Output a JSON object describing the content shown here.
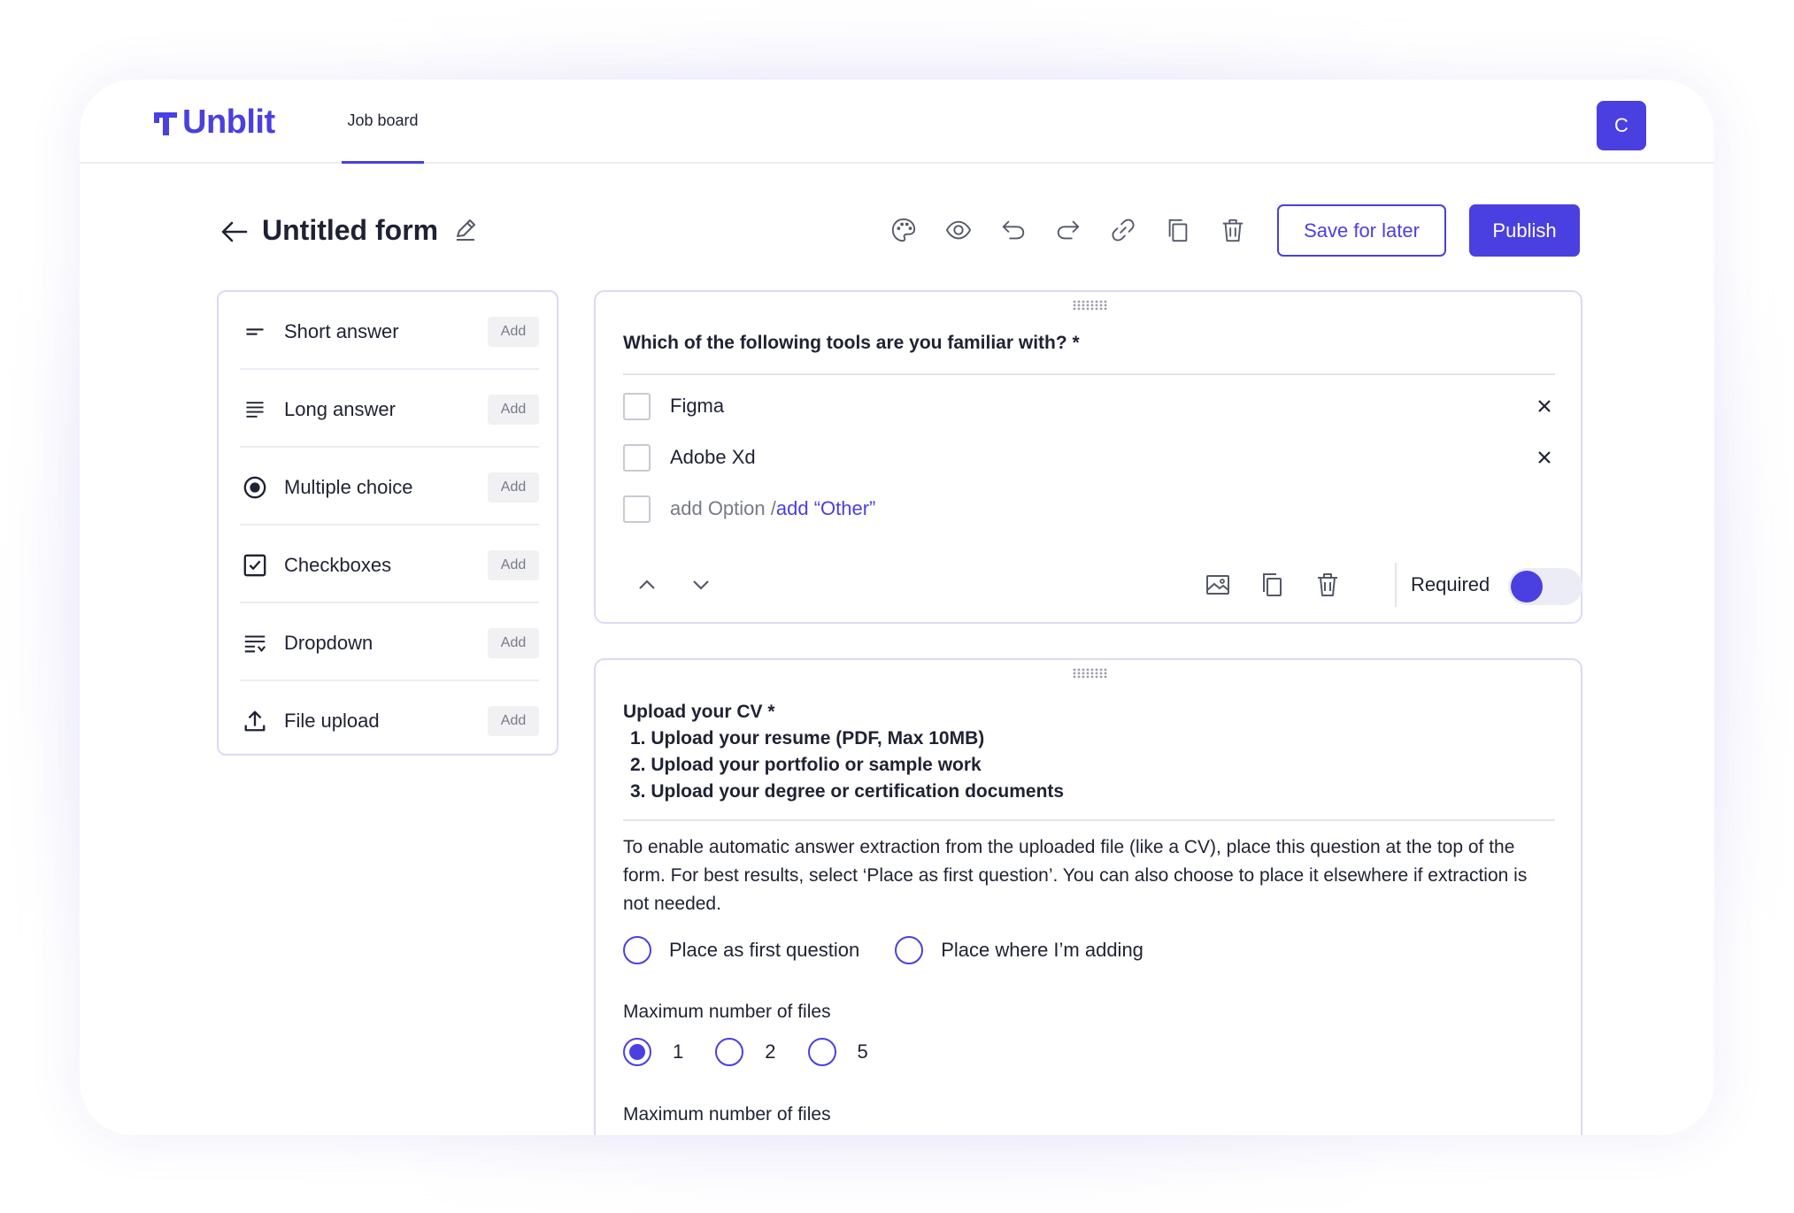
{
  "app": {
    "logo_text": "Unblit",
    "nav_tab": "Job board",
    "avatar_initial": "C",
    "accent_color": "#4a3fe0"
  },
  "form": {
    "title": "Untitled form",
    "save_label": "Save for later",
    "publish_label": "Publish",
    "toolbar_icons": [
      "palette-icon",
      "eye-icon",
      "undo-icon",
      "redo-icon",
      "link-icon",
      "copy-icon",
      "trash-icon"
    ]
  },
  "sidebar": {
    "add_label": "Add",
    "items": [
      {
        "label": "Short answer",
        "icon": "short-answer-icon"
      },
      {
        "label": "Long answer",
        "icon": "long-answer-icon"
      },
      {
        "label": "Multiple choice",
        "icon": "radio-icon"
      },
      {
        "label": "Checkboxes",
        "icon": "checkbox-icon"
      },
      {
        "label": "Dropdown",
        "icon": "dropdown-icon"
      },
      {
        "label": "File upload",
        "icon": "upload-icon"
      }
    ]
  },
  "question1": {
    "title": "Which of the following tools are you familiar with? *",
    "options": [
      "Figma",
      "Adobe Xd"
    ],
    "add_option": "add Option / ",
    "add_other": "add “Other”",
    "required_label": "Required",
    "required": true
  },
  "question2": {
    "title": "Upload your CV *",
    "list": [
      "1. Upload your resume (PDF, Max 10MB)",
      "2. Upload your portfolio or sample work",
      "3. Upload your degree or certification documents"
    ],
    "description": "To enable automatic answer extraction from the uploaded file (like a CV), place this question at the top of the form. For best results, select ‘Place as first question’. You can also choose to place it elsewhere if extraction is not needed.",
    "placement_options": [
      "Place as first question",
      "Place where I’m adding"
    ],
    "max_files_label": "Maximum number of files",
    "max_files_options": [
      "1",
      "2",
      "5"
    ],
    "max_files_selected": "1",
    "max_files_label_2": "Maximum number of files"
  }
}
